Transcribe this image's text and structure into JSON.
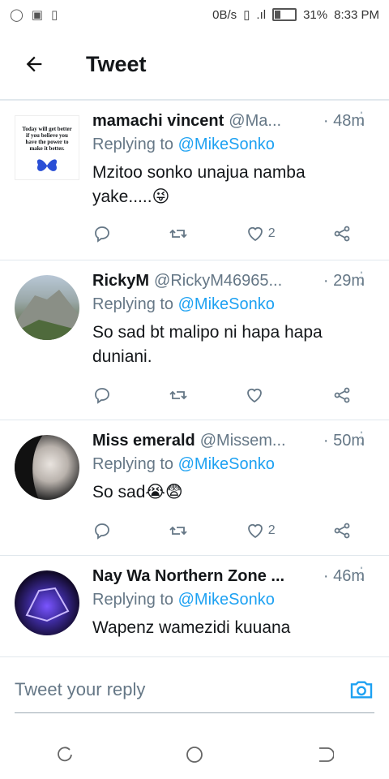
{
  "status_bar": {
    "speed": "0B/s",
    "battery": "31%",
    "time": "8:33 PM"
  },
  "header": {
    "title": "Tweet"
  },
  "tweets": [
    {
      "name": "mamachi vincent",
      "handle": "@Ma...",
      "time": "· 48m",
      "reply_prefix": "Replying to ",
      "reply_user": "@MikeSonko",
      "text": "Mzitoo sonko unajua namba yake.....😜",
      "likes": "2",
      "avatar_text": "Today will get better if you believe you have the power to make it better."
    },
    {
      "name": "RickyM",
      "handle": "@RickyM46965...",
      "time": "· 29m",
      "reply_prefix": "Replying to ",
      "reply_user": "@MikeSonko",
      "text": "So sad bt malipo ni hapa hapa duniani.",
      "likes": ""
    },
    {
      "name": "Miss emerald",
      "handle": "@Missem...",
      "time": "· 50m",
      "reply_prefix": "Replying to ",
      "reply_user": "@MikeSonko",
      "text": "So sad😭😨",
      "likes": "2"
    },
    {
      "name": "Nay Wa Northern Zone ...",
      "handle": "",
      "time": "· 46m",
      "reply_prefix": "Replying to ",
      "reply_user": "@MikeSonko",
      "text": "Wapenz wamezidi kuuana",
      "likes": ""
    }
  ],
  "compose": {
    "placeholder": "Tweet your reply"
  }
}
